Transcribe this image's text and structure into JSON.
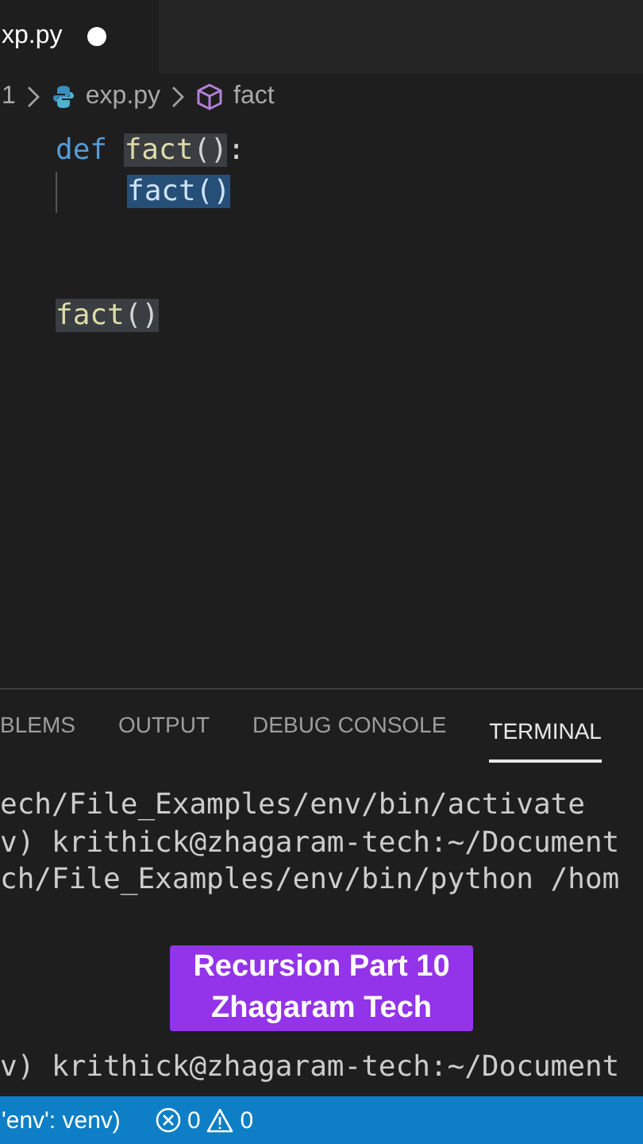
{
  "editor_tab": {
    "label": "xp.py",
    "modified": true
  },
  "breadcrumb": [
    {
      "label": "1",
      "kind": "folder"
    },
    {
      "label": "exp.py",
      "kind": "file"
    },
    {
      "label": "fact",
      "kind": "symbol"
    }
  ],
  "code_lines": [
    {
      "kind": "code",
      "indented": false,
      "tokens": [
        {
          "text": "def",
          "kind": "keyword",
          "matched": false,
          "selected": false
        },
        {
          "text": "fact",
          "kind": "function",
          "matched": true,
          "selected": false
        },
        {
          "text": "()",
          "kind": "punct",
          "matched": true,
          "selected": false
        },
        {
          "text": ":",
          "kind": "punct",
          "matched": false,
          "selected": false
        }
      ]
    },
    {
      "kind": "code",
      "indented": true,
      "tokens": [
        {
          "text": "fact",
          "kind": "function",
          "selected": true
        },
        {
          "text": "()",
          "kind": "punct",
          "selected": true
        }
      ]
    },
    {
      "kind": "blank"
    },
    {
      "kind": "blank"
    },
    {
      "kind": "code",
      "indented": false,
      "tokens": [
        {
          "text": "fact",
          "kind": "function",
          "matched": true,
          "selected": false
        },
        {
          "text": "()",
          "kind": "punct",
          "matched": true,
          "selected": false
        }
      ]
    }
  ],
  "panel_tabs": [
    {
      "label": "BLEMS",
      "selected": false
    },
    {
      "label": "OUTPUT",
      "selected": false
    },
    {
      "label": "DEBUG CONSOLE",
      "selected": false
    },
    {
      "label": "TERMINAL",
      "selected": true
    }
  ],
  "terminal_lines": [
    {
      "kind": "text",
      "text": "ech/File_Examples/env/bin/activate"
    },
    {
      "kind": "text",
      "text": "v) krithick@zhagaram-tech:~/Document"
    },
    {
      "kind": "text",
      "text": "ch/File_Examples/env/bin/python /hom"
    },
    {
      "kind": "blank"
    },
    {
      "kind": "blank"
    },
    {
      "kind": "blank"
    },
    {
      "kind": "blank"
    },
    {
      "kind": "text",
      "text": "v) krithick@zhagaram-tech:~/Document"
    }
  ],
  "caption": {
    "lines": [
      "Recursion Part 10",
      "Zhagaram Tech"
    ]
  },
  "status_bar": {
    "interpreter": "'env': venv)",
    "errors": "0",
    "warnings": "0"
  }
}
